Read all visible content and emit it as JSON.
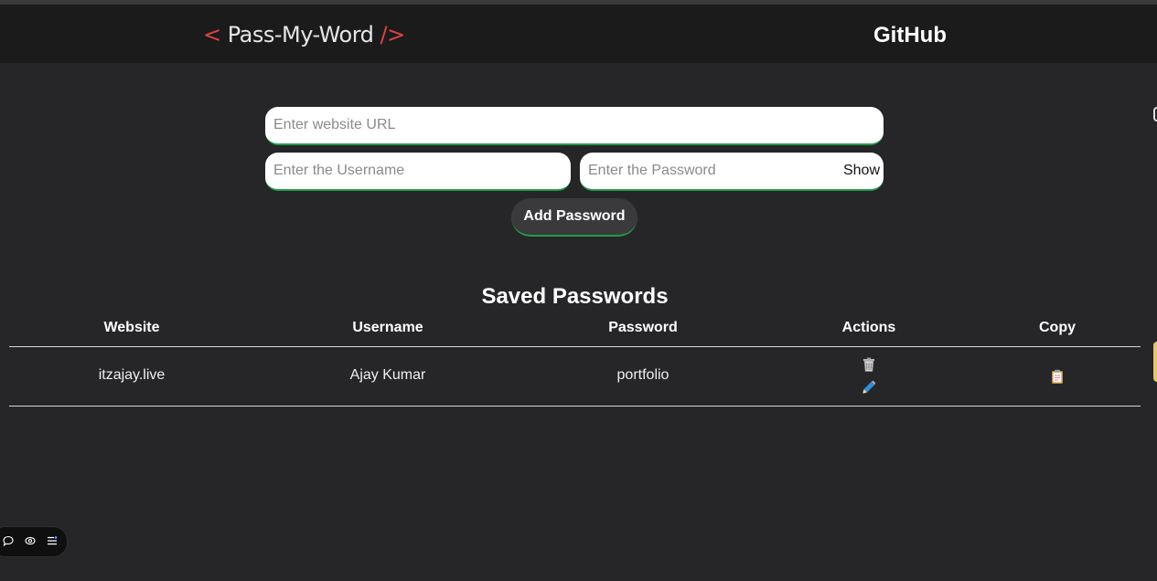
{
  "navbar": {
    "logo_open": "<",
    "logo_text": " Pass-My-Word ",
    "logo_close": "/>",
    "github_label": "GitHub"
  },
  "form": {
    "url_placeholder": "Enter website URL",
    "url_value": "",
    "username_placeholder": "Enter the Username",
    "username_value": "",
    "password_placeholder": "Enter the Password",
    "password_value": "",
    "show_label": "Show",
    "add_button_label": "Add Password"
  },
  "table": {
    "title": "Saved Passwords",
    "headers": [
      "Website",
      "Username",
      "Password",
      "Actions",
      "Copy"
    ],
    "rows": [
      {
        "website": "itzajay.live",
        "username": "Ajay Kumar",
        "password": "portfolio",
        "action_icons": [
          "trash-icon",
          "edit-pen-icon"
        ],
        "copy_icon": "clipboard-icon"
      }
    ]
  },
  "colors": {
    "background": "#262628",
    "navbar": "#1b1b1c",
    "accent_red": "#e0433f",
    "accent_green": "#1f9d4a"
  },
  "widget_icons": [
    "comment-icon",
    "eye-icon",
    "menu-icon"
  ]
}
